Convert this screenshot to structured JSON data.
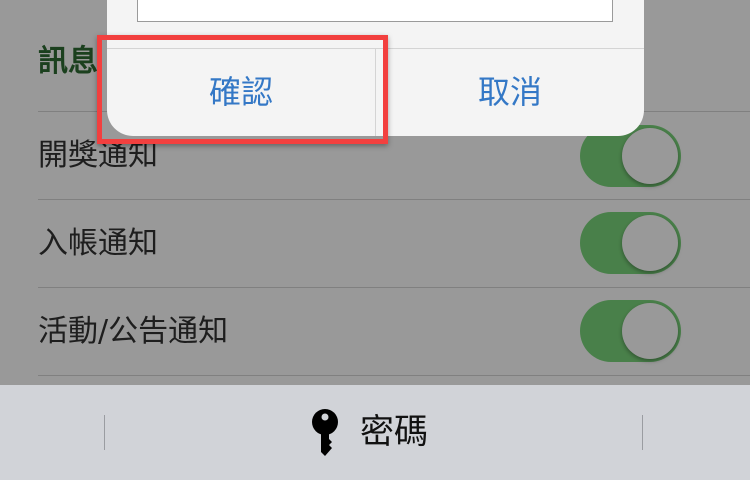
{
  "settings": {
    "section_title": "訊息",
    "rows": [
      {
        "label": "開獎通知",
        "toggle_on": true
      },
      {
        "label": "入帳通知",
        "toggle_on": true
      },
      {
        "label": "活動/公告通知",
        "toggle_on": true
      }
    ]
  },
  "dialog": {
    "input_value": "",
    "confirm_label": "確認",
    "cancel_label": "取消"
  },
  "keyboard_bar": {
    "password_label": "密碼",
    "icon": "key-icon"
  },
  "colors": {
    "accent_green": "#2e6b33",
    "toggle_green": "#7bd67c",
    "link_blue": "#3478c6",
    "highlight_red": "#f2403f"
  }
}
